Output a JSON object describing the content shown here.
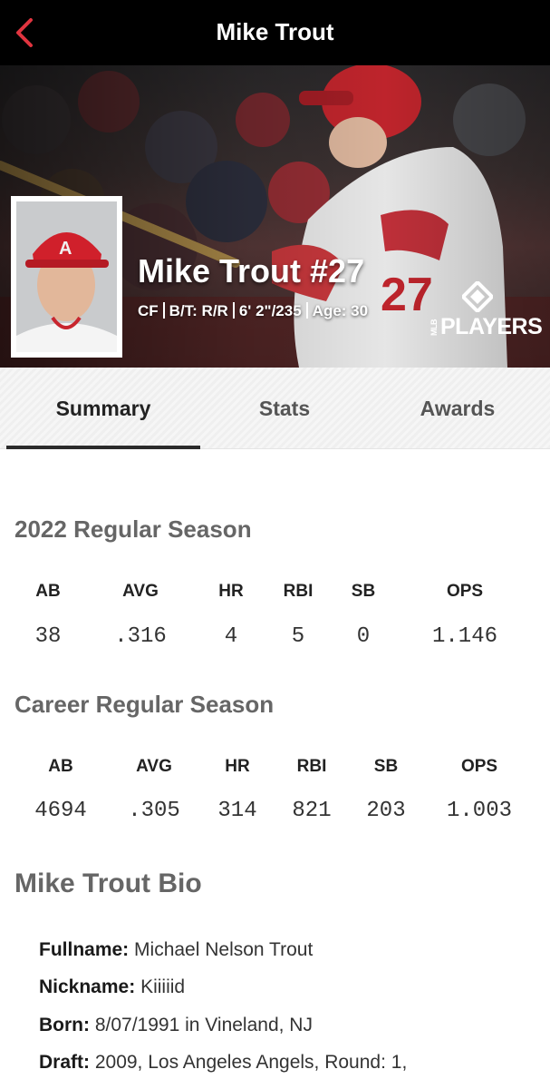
{
  "nav": {
    "title": "Mike Trout",
    "back_icon": "chevron-left-icon",
    "accent_color": "#e0343f"
  },
  "hero": {
    "name_number": "Mike Trout #27",
    "meta": [
      "CF",
      "B/T: R/R",
      "6' 2\"/235",
      "Age: 30"
    ],
    "logo": {
      "small": "MLB",
      "main": "PLAYERS"
    }
  },
  "tabs": [
    {
      "label": "Summary",
      "active": true
    },
    {
      "label": "Stats",
      "active": false
    },
    {
      "label": "Awards",
      "active": false
    }
  ],
  "season": {
    "title": "2022 Regular Season",
    "headers": [
      "AB",
      "AVG",
      "HR",
      "RBI",
      "SB",
      "OPS"
    ],
    "values": [
      "38",
      ".316",
      "4",
      "5",
      "0",
      "1.146"
    ]
  },
  "career": {
    "title": "Career Regular Season",
    "headers": [
      "AB",
      "AVG",
      "HR",
      "RBI",
      "SB",
      "OPS"
    ],
    "values": [
      "4694",
      ".305",
      "314",
      "821",
      "203",
      "1.003"
    ]
  },
  "bio": {
    "title": "Mike Trout Bio",
    "rows": [
      {
        "label": "Fullname:",
        "value": "Michael Nelson Trout"
      },
      {
        "label": "Nickname:",
        "value": "Kiiiiid"
      },
      {
        "label": "Born:",
        "value": "8/07/1991 in Vineland, NJ"
      },
      {
        "label": "Draft:",
        "value": "2009, Los Angeles Angels, Round: 1,"
      }
    ]
  }
}
